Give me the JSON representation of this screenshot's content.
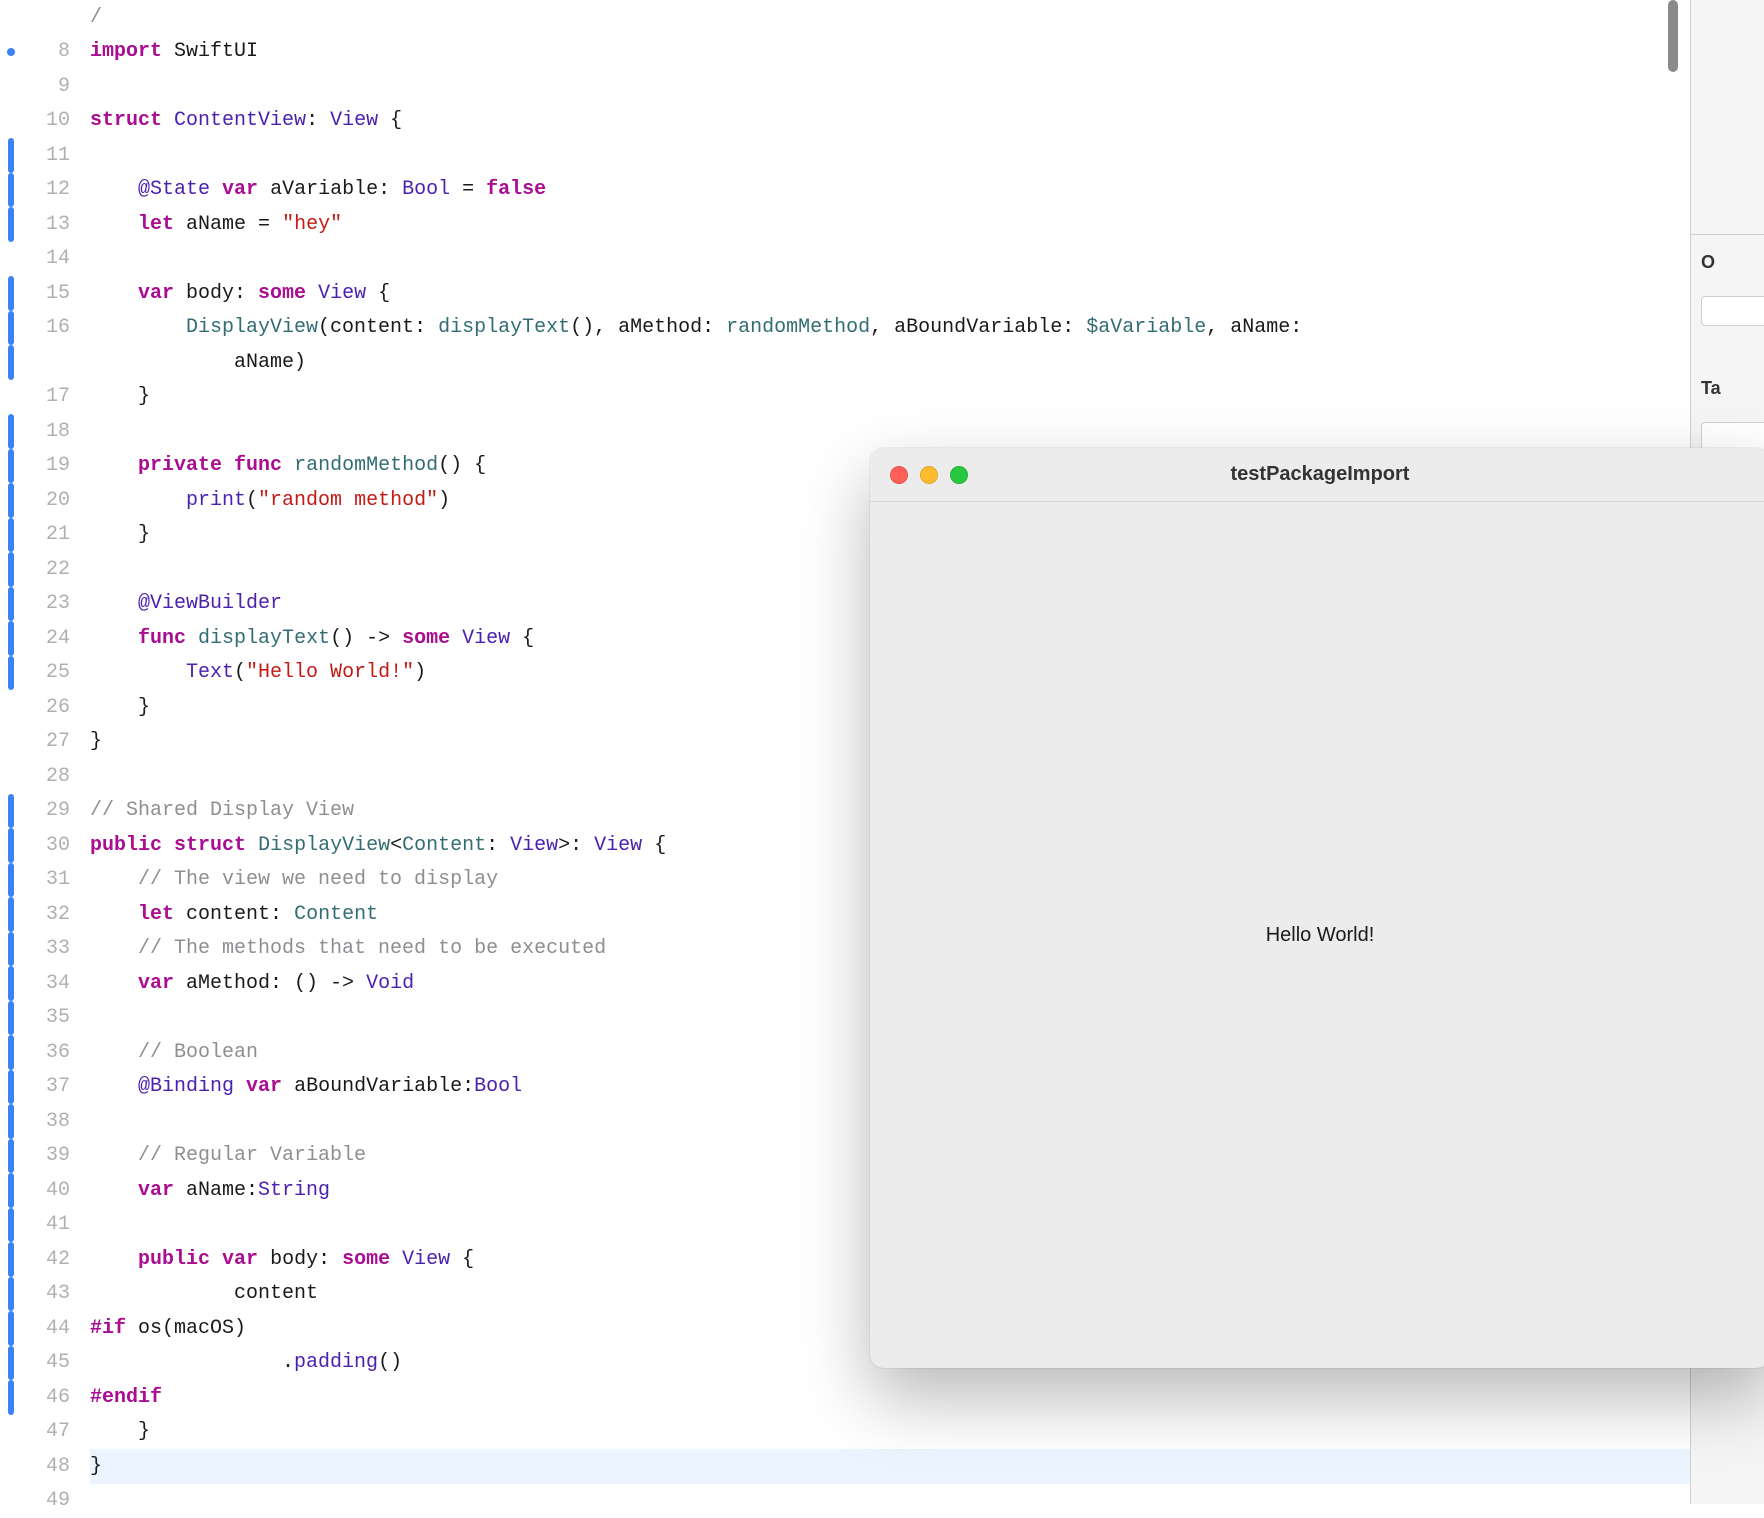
{
  "gutter": {
    "lines": [
      {
        "num": "",
        "bar": false,
        "dot": false
      },
      {
        "num": "8",
        "bar": false,
        "dot": true
      },
      {
        "num": "9",
        "bar": false,
        "dot": false
      },
      {
        "num": "10",
        "bar": false,
        "dot": false
      },
      {
        "num": "11",
        "bar": true,
        "dot": false
      },
      {
        "num": "12",
        "bar": true,
        "dot": false
      },
      {
        "num": "13",
        "bar": true,
        "dot": false
      },
      {
        "num": "14",
        "bar": false,
        "dot": false
      },
      {
        "num": "15",
        "bar": true,
        "dot": false
      },
      {
        "num": "16",
        "bar": true,
        "dot": false
      },
      {
        "num": "",
        "bar": true,
        "dot": false
      },
      {
        "num": "17",
        "bar": false,
        "dot": false
      },
      {
        "num": "18",
        "bar": true,
        "dot": false
      },
      {
        "num": "19",
        "bar": true,
        "dot": false
      },
      {
        "num": "20",
        "bar": true,
        "dot": false
      },
      {
        "num": "21",
        "bar": true,
        "dot": false
      },
      {
        "num": "22",
        "bar": true,
        "dot": false
      },
      {
        "num": "23",
        "bar": true,
        "dot": false
      },
      {
        "num": "24",
        "bar": true,
        "dot": false
      },
      {
        "num": "25",
        "bar": true,
        "dot": false
      },
      {
        "num": "26",
        "bar": false,
        "dot": false
      },
      {
        "num": "27",
        "bar": false,
        "dot": false
      },
      {
        "num": "28",
        "bar": false,
        "dot": false
      },
      {
        "num": "29",
        "bar": true,
        "dot": false
      },
      {
        "num": "30",
        "bar": true,
        "dot": false
      },
      {
        "num": "31",
        "bar": true,
        "dot": false
      },
      {
        "num": "32",
        "bar": true,
        "dot": false
      },
      {
        "num": "33",
        "bar": true,
        "dot": false
      },
      {
        "num": "34",
        "bar": true,
        "dot": false
      },
      {
        "num": "35",
        "bar": true,
        "dot": false
      },
      {
        "num": "36",
        "bar": true,
        "dot": false
      },
      {
        "num": "37",
        "bar": true,
        "dot": false
      },
      {
        "num": "38",
        "bar": true,
        "dot": false
      },
      {
        "num": "39",
        "bar": true,
        "dot": false
      },
      {
        "num": "40",
        "bar": true,
        "dot": false
      },
      {
        "num": "41",
        "bar": true,
        "dot": false
      },
      {
        "num": "42",
        "bar": true,
        "dot": false
      },
      {
        "num": "43",
        "bar": true,
        "dot": false
      },
      {
        "num": "44",
        "bar": true,
        "dot": false
      },
      {
        "num": "45",
        "bar": true,
        "dot": false
      },
      {
        "num": "46",
        "bar": true,
        "dot": false
      },
      {
        "num": "47",
        "bar": false,
        "dot": false
      },
      {
        "num": "48",
        "bar": false,
        "dot": false
      },
      {
        "num": "49",
        "bar": false,
        "dot": false
      }
    ]
  },
  "code": {
    "7": [
      {
        "t": "/",
        "c": "comment"
      }
    ],
    "8": [
      {
        "t": "import",
        "c": "keyword"
      },
      {
        "t": " SwiftUI",
        "c": "plain"
      }
    ],
    "9": [],
    "10": [
      {
        "t": "struct",
        "c": "keyword"
      },
      {
        "t": " ",
        "c": "plain"
      },
      {
        "t": "ContentView",
        "c": "type"
      },
      {
        "t": ": ",
        "c": "plain"
      },
      {
        "t": "View",
        "c": "type"
      },
      {
        "t": " {",
        "c": "plain"
      }
    ],
    "11": [],
    "12": [
      {
        "t": "    ",
        "c": "plain"
      },
      {
        "t": "@State",
        "c": "type"
      },
      {
        "t": " ",
        "c": "plain"
      },
      {
        "t": "var",
        "c": "keyword"
      },
      {
        "t": " aVariable: ",
        "c": "plain"
      },
      {
        "t": "Bool",
        "c": "type"
      },
      {
        "t": " = ",
        "c": "plain"
      },
      {
        "t": "false",
        "c": "keyword"
      }
    ],
    "13": [
      {
        "t": "    ",
        "c": "plain"
      },
      {
        "t": "let",
        "c": "keyword"
      },
      {
        "t": " aName = ",
        "c": "plain"
      },
      {
        "t": "\"hey\"",
        "c": "string"
      }
    ],
    "14": [],
    "15": [
      {
        "t": "    ",
        "c": "plain"
      },
      {
        "t": "var",
        "c": "keyword"
      },
      {
        "t": " body: ",
        "c": "plain"
      },
      {
        "t": "some",
        "c": "keyword"
      },
      {
        "t": " ",
        "c": "plain"
      },
      {
        "t": "View",
        "c": "type"
      },
      {
        "t": " {",
        "c": "plain"
      }
    ],
    "16": [
      {
        "t": "        ",
        "c": "plain"
      },
      {
        "t": "DisplayView",
        "c": "var2"
      },
      {
        "t": "(content: ",
        "c": "plain"
      },
      {
        "t": "displayText",
        "c": "var2"
      },
      {
        "t": "(), aMethod: ",
        "c": "plain"
      },
      {
        "t": "randomMethod",
        "c": "var2"
      },
      {
        "t": ", aBoundVariable: ",
        "c": "plain"
      },
      {
        "t": "$aVariable",
        "c": "var2"
      },
      {
        "t": ", aName:",
        "c": "plain"
      }
    ],
    "16b": [
      {
        "t": "            aName)",
        "c": "plain"
      }
    ],
    "17": [
      {
        "t": "    }",
        "c": "plain"
      }
    ],
    "18": [],
    "19": [
      {
        "t": "    ",
        "c": "plain"
      },
      {
        "t": "private",
        "c": "keyword"
      },
      {
        "t": " ",
        "c": "plain"
      },
      {
        "t": "func",
        "c": "keyword"
      },
      {
        "t": " ",
        "c": "plain"
      },
      {
        "t": "randomMethod",
        "c": "var2"
      },
      {
        "t": "() {",
        "c": "plain"
      }
    ],
    "20": [
      {
        "t": "        ",
        "c": "plain"
      },
      {
        "t": "print",
        "c": "type"
      },
      {
        "t": "(",
        "c": "plain"
      },
      {
        "t": "\"random method\"",
        "c": "string"
      },
      {
        "t": ")",
        "c": "plain"
      }
    ],
    "21": [
      {
        "t": "    }",
        "c": "plain"
      }
    ],
    "22": [],
    "23": [
      {
        "t": "    ",
        "c": "plain"
      },
      {
        "t": "@ViewBuilder",
        "c": "type"
      }
    ],
    "24": [
      {
        "t": "    ",
        "c": "plain"
      },
      {
        "t": "func",
        "c": "keyword"
      },
      {
        "t": " ",
        "c": "plain"
      },
      {
        "t": "displayText",
        "c": "var2"
      },
      {
        "t": "() -> ",
        "c": "plain"
      },
      {
        "t": "some",
        "c": "keyword"
      },
      {
        "t": " ",
        "c": "plain"
      },
      {
        "t": "View",
        "c": "type"
      },
      {
        "t": " {",
        "c": "plain"
      }
    ],
    "25": [
      {
        "t": "        ",
        "c": "plain"
      },
      {
        "t": "Text",
        "c": "type"
      },
      {
        "t": "(",
        "c": "plain"
      },
      {
        "t": "\"Hello World!\"",
        "c": "string"
      },
      {
        "t": ")",
        "c": "plain"
      }
    ],
    "26": [
      {
        "t": "    }",
        "c": "plain"
      }
    ],
    "27": [
      {
        "t": "}",
        "c": "plain"
      }
    ],
    "28": [],
    "29": [
      {
        "t": "// Shared Display View",
        "c": "comment"
      }
    ],
    "30": [
      {
        "t": "public",
        "c": "keyword"
      },
      {
        "t": " ",
        "c": "plain"
      },
      {
        "t": "struct",
        "c": "keyword"
      },
      {
        "t": " ",
        "c": "plain"
      },
      {
        "t": "DisplayView",
        "c": "var2"
      },
      {
        "t": "<",
        "c": "plain"
      },
      {
        "t": "Content",
        "c": "var2"
      },
      {
        "t": ": ",
        "c": "plain"
      },
      {
        "t": "View",
        "c": "type"
      },
      {
        "t": ">: ",
        "c": "plain"
      },
      {
        "t": "View",
        "c": "type"
      },
      {
        "t": " {",
        "c": "plain"
      }
    ],
    "31": [
      {
        "t": "    ",
        "c": "plain"
      },
      {
        "t": "// The view we need to display",
        "c": "comment"
      }
    ],
    "32": [
      {
        "t": "    ",
        "c": "plain"
      },
      {
        "t": "let",
        "c": "keyword"
      },
      {
        "t": " content: ",
        "c": "plain"
      },
      {
        "t": "Content",
        "c": "var2"
      }
    ],
    "33": [
      {
        "t": "    ",
        "c": "plain"
      },
      {
        "t": "// The methods that need to be executed",
        "c": "comment"
      }
    ],
    "34": [
      {
        "t": "    ",
        "c": "plain"
      },
      {
        "t": "var",
        "c": "keyword"
      },
      {
        "t": " aMethod: () -> ",
        "c": "plain"
      },
      {
        "t": "Void",
        "c": "type"
      }
    ],
    "35": [],
    "36": [
      {
        "t": "    ",
        "c": "plain"
      },
      {
        "t": "// Boolean",
        "c": "comment"
      }
    ],
    "37": [
      {
        "t": "    ",
        "c": "plain"
      },
      {
        "t": "@Binding",
        "c": "type"
      },
      {
        "t": " ",
        "c": "plain"
      },
      {
        "t": "var",
        "c": "keyword"
      },
      {
        "t": " aBoundVariable:",
        "c": "plain"
      },
      {
        "t": "Bool",
        "c": "type"
      }
    ],
    "38": [],
    "39": [
      {
        "t": "    ",
        "c": "plain"
      },
      {
        "t": "// Regular Variable",
        "c": "comment"
      }
    ],
    "40": [
      {
        "t": "    ",
        "c": "plain"
      },
      {
        "t": "var",
        "c": "keyword"
      },
      {
        "t": " aName:",
        "c": "plain"
      },
      {
        "t": "String",
        "c": "type"
      }
    ],
    "41": [],
    "42": [
      {
        "t": "    ",
        "c": "plain"
      },
      {
        "t": "public",
        "c": "keyword"
      },
      {
        "t": " ",
        "c": "plain"
      },
      {
        "t": "var",
        "c": "keyword"
      },
      {
        "t": " body: ",
        "c": "plain"
      },
      {
        "t": "some",
        "c": "keyword"
      },
      {
        "t": " ",
        "c": "plain"
      },
      {
        "t": "View",
        "c": "type"
      },
      {
        "t": " {",
        "c": "plain"
      }
    ],
    "43": [
      {
        "t": "            content",
        "c": "plain"
      }
    ],
    "44": [
      {
        "t": "#if",
        "c": "keyword"
      },
      {
        "t": " os(macOS)",
        "c": "plain"
      }
    ],
    "45": [
      {
        "t": "                .",
        "c": "plain"
      },
      {
        "t": "padding",
        "c": "type"
      },
      {
        "t": "()",
        "c": "plain"
      }
    ],
    "46": [
      {
        "t": "#endif",
        "c": "keyword"
      }
    ],
    "47": [
      {
        "t": "    }",
        "c": "plain"
      }
    ],
    "48": [
      {
        "t": "}",
        "c": "plain"
      }
    ],
    "49": []
  },
  "code_keys": [
    "7",
    "8",
    "9",
    "10",
    "11",
    "12",
    "13",
    "14",
    "15",
    "16",
    "16b",
    "17",
    "18",
    "19",
    "20",
    "21",
    "22",
    "23",
    "24",
    "25",
    "26",
    "27",
    "28",
    "29",
    "30",
    "31",
    "32",
    "33",
    "34",
    "35",
    "36",
    "37",
    "38",
    "39",
    "40",
    "41",
    "42",
    "43",
    "44",
    "45",
    "46",
    "47",
    "48",
    "49"
  ],
  "highlighted_key": "48",
  "preview": {
    "title": "testPackageImport",
    "content": "Hello World!"
  },
  "inspector": {
    "label1": "O",
    "label2": "Ta"
  }
}
